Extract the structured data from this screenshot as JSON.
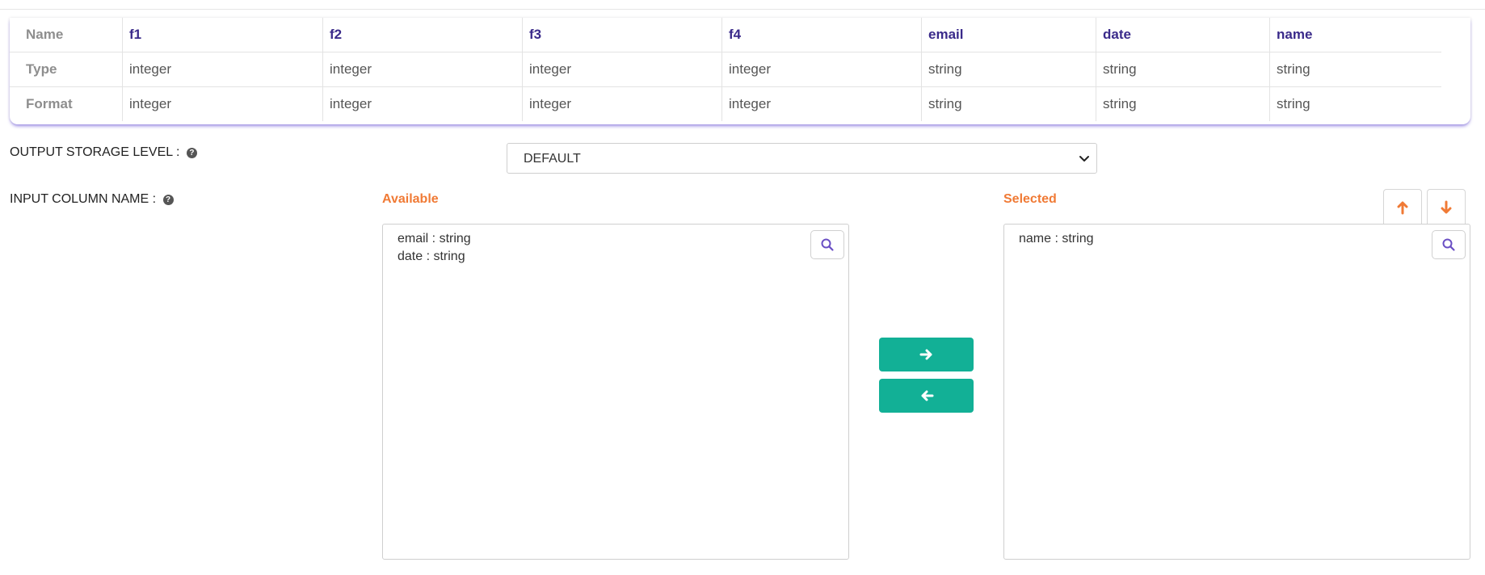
{
  "schema_table": {
    "rows": [
      {
        "header": "Name",
        "cells": [
          "f1",
          "f2",
          "f3",
          "f4",
          "email",
          "date",
          "name"
        ]
      },
      {
        "header": "Type",
        "cells": [
          "integer",
          "integer",
          "integer",
          "integer",
          "string",
          "string",
          "string"
        ]
      },
      {
        "header": "Format",
        "cells": [
          "integer",
          "integer",
          "integer",
          "integer",
          "string",
          "string",
          "string"
        ]
      }
    ]
  },
  "output_storage": {
    "label": "OUTPUT STORAGE LEVEL :",
    "selected": "DEFAULT"
  },
  "input_column": {
    "label": "INPUT COLUMN NAME :"
  },
  "available": {
    "title": "Available",
    "items": [
      "email : string",
      "date : string"
    ]
  },
  "selected": {
    "title": "Selected",
    "items": [
      "name : string"
    ]
  },
  "icons": {
    "help": "question-circle-icon",
    "search": "search-icon",
    "move_right": "arrow-right-icon",
    "move_left": "arrow-left-icon",
    "move_up": "arrow-up-icon",
    "move_down": "arrow-down-icon",
    "dropdown": "chevron-down-icon"
  },
  "colors": {
    "accent_orange": "#f07a35",
    "teal_button": "#12b096",
    "name_row_text": "#3a2a8a",
    "search_icon": "#6a4fc4"
  }
}
